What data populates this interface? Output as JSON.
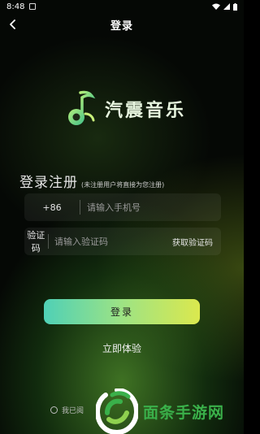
{
  "status_bar": {
    "time": "8:48"
  },
  "header": {
    "title": "登录"
  },
  "logo": {
    "text": "汽震音乐"
  },
  "register": {
    "title": "登录注册",
    "hint": "(未注册用户将直接为您注册)"
  },
  "phone_field": {
    "prefix": "+86",
    "placeholder": "请输入手机号",
    "value": ""
  },
  "code_field": {
    "label": "验证码",
    "placeholder": "请输入验证码",
    "value": "",
    "get_code_label": "获取验证码"
  },
  "login_button": {
    "label": "登录"
  },
  "try_link": {
    "label": "立即体验"
  },
  "agreement": {
    "text": "我已阅"
  },
  "watermark": {
    "text": "面条手游网"
  },
  "colors": {
    "accent_start": "#4fd0b6",
    "accent_end": "#dbe84e",
    "watermark": "#3ab04a"
  }
}
